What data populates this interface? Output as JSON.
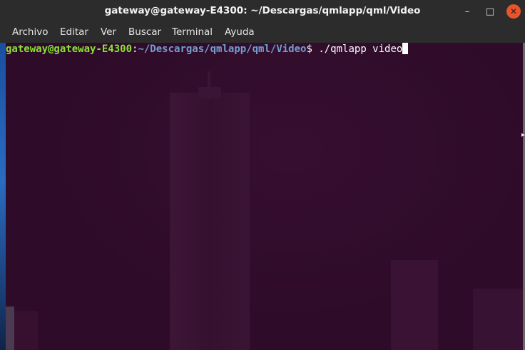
{
  "window": {
    "title": "gateway@gateway-E4300: ~/Descargas/qmlapp/qml/Video",
    "minimize_glyph": "–",
    "maximize_glyph": "□",
    "close_glyph": "✕",
    "close_color": "#e9542b"
  },
  "menu": {
    "items": [
      "Archivo",
      "Editar",
      "Ver",
      "Buscar",
      "Terminal",
      "Ayuda"
    ]
  },
  "terminal": {
    "background": "#2e0c29",
    "prompt_user": "gateway@gateway-E4300",
    "prompt_colon": ":",
    "prompt_path": "~/Descargas/qmlapp/qml/Video",
    "prompt_symbol": "$ ",
    "command": "./qmlapp video",
    "user_color": "#8ae234",
    "path_color": "#729fcf"
  },
  "icons": {
    "minimize": "minimize-icon",
    "maximize": "maximize-icon",
    "close": "close-icon",
    "scroll": "chevron-right-icon"
  }
}
